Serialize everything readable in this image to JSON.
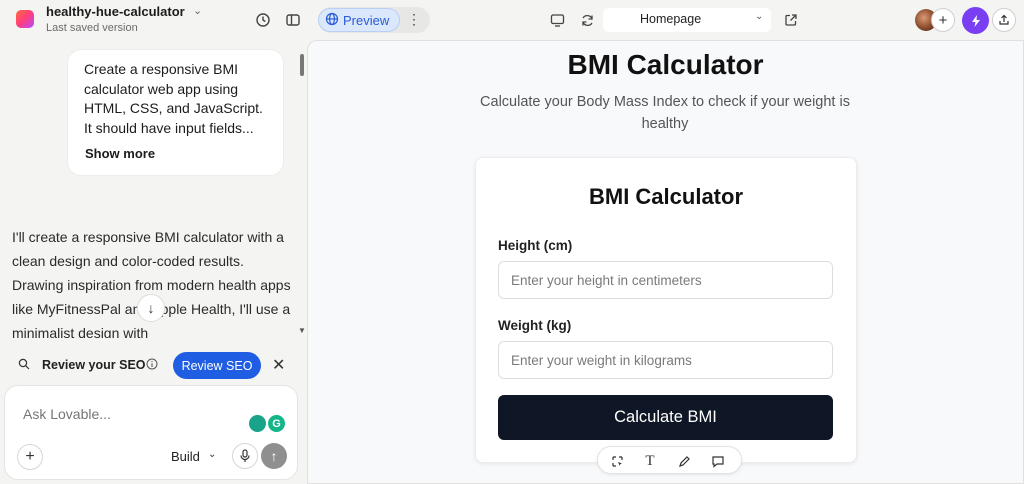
{
  "project": {
    "name": "healthy-hue-calculator",
    "subtitle": "Last saved version"
  },
  "toolbar": {
    "preview_label": "Preview",
    "route": "Homepage"
  },
  "chat": {
    "user_message": "Create a responsive BMI calculator web app using HTML, CSS, and JavaScript. It should have input fields...",
    "show_more": "Show more",
    "assistant_message": "I'll create a responsive BMI calculator with a clean design and color-coded results. Drawing inspiration from modern health apps like MyFitnessPal and Apple Health, I'll use a minimalist design with",
    "seo_prompt": "Review your SEO",
    "seo_button": "Review SEO",
    "input_placeholder": "Ask Lovable...",
    "mode": "Build"
  },
  "app": {
    "title": "BMI Calculator",
    "subtitle": "Calculate your Body Mass Index to check if your weight is healthy",
    "card_title": "BMI Calculator",
    "height_label": "Height (cm)",
    "height_placeholder": "Enter your height in centimeters",
    "weight_label": "Weight (kg)",
    "weight_placeholder": "Enter your weight in kilograms",
    "calculate_label": "Calculate BMI"
  },
  "colors": {
    "accent": "#1f5de2",
    "bolt": "#7a3ff2",
    "button_dark": "#0f1625"
  }
}
